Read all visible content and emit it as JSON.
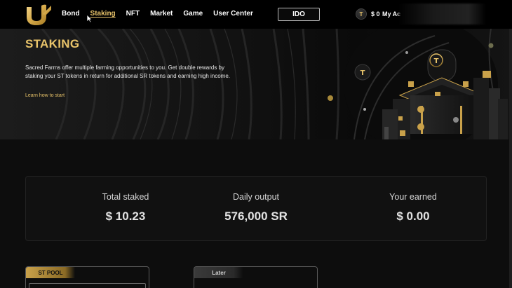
{
  "nav": {
    "items": [
      {
        "label": "Bond"
      },
      {
        "label": "Staking"
      },
      {
        "label": "NFT"
      },
      {
        "label": "Market"
      },
      {
        "label": "Game"
      },
      {
        "label": "User Center"
      }
    ],
    "active": "Staking",
    "ido_label": "IDO",
    "balance": "$ 0",
    "account_label": "My Ac"
  },
  "hero": {
    "title": "STAKING",
    "description": "Sacred Farms offer multiple farming opportunities to you. Get double rewards by staking your ST tokens in return for additional SR tokens and earning high income.",
    "link": "Learn how to start"
  },
  "stats": [
    {
      "label": "Total staked",
      "value": "$ 10.23"
    },
    {
      "label": "Daily output",
      "value": "576,000 SR"
    },
    {
      "label": "Your earned",
      "value": "$ 0.00"
    }
  ],
  "pools": [
    {
      "tab": "ST POOL"
    },
    {
      "tab": "Later"
    }
  ],
  "colors": {
    "accent": "#e9c46a",
    "background": "#0d0d0d",
    "header": "#000000"
  }
}
